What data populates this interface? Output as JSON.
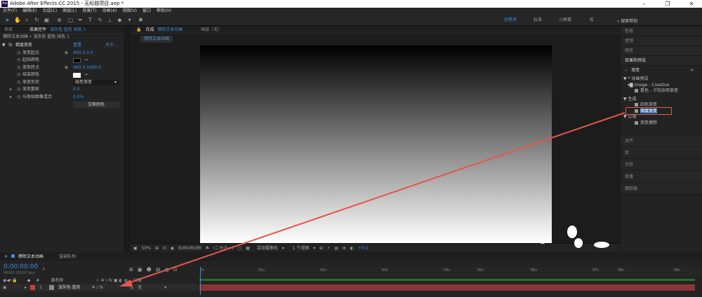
{
  "window": {
    "title": "Adobe After Effects CC 2015 - 无标题项目.aep *",
    "logo": "Ae"
  },
  "menu": [
    "文件(F)",
    "编辑(E)",
    "合成(C)",
    "图层(L)",
    "效果(T)",
    "动画(A)",
    "视图(V)",
    "窗口",
    "帮助(H)"
  ],
  "workspaces": [
    {
      "label": "创意项",
      "active": true
    },
    {
      "label": "标准",
      "active": false
    },
    {
      "label": "小屏幕",
      "active": false
    },
    {
      "label": "库",
      "active": false
    }
  ],
  "search": {
    "label": "搜索帮助"
  },
  "left": {
    "tab_project": "项目",
    "tab_fx": "效果控件",
    "tab_fx_layer": "浅灰色·蓝色 纯色 1",
    "breadcrumb": "擦除文本动画 • 浅灰色·蓝色 纯色 1",
    "effect": {
      "name": "梯度渐变",
      "reset": "重置",
      "about": "关于..."
    },
    "rows": [
      {
        "label": "渐变起点",
        "value": "960.0,0.0"
      },
      {
        "label": "起始颜色",
        "swatch": "#000000"
      },
      {
        "label": "渐变终点",
        "value": "960.0,1080.0"
      },
      {
        "label": "结束颜色",
        "swatch": "#ffffff"
      },
      {
        "label": "渐变形状",
        "value": "线性渐变"
      },
      {
        "label": "渐变散射",
        "value": "0.0"
      },
      {
        "label": "与原始图像混合",
        "value": "0.0%"
      }
    ],
    "swap_button": "交换颜色"
  },
  "comp": {
    "tab": "合成",
    "tab_name": "擦除文本动画",
    "tab_layer": "图层（无）",
    "subtab": "擦除文本动画",
    "zoom": "50%",
    "timecode": "0;00;00;00",
    "resolution": "(二分之一)",
    "camera": "活动摄像机",
    "views": "1 个视图",
    "exposure": "+0.0"
  },
  "right": {
    "top_sections": [
      "信息",
      "音频",
      "预览"
    ],
    "effects_header": "效果和预设",
    "search_value": "渐变",
    "tree": [
      {
        "text": "* 动画预设",
        "indent": 0,
        "kind": "folder"
      },
      {
        "text": "Image - Creative",
        "indent": 1,
        "kind": "folder"
      },
      {
        "text": "看色 - 夕阳余晖渐变",
        "indent": 2,
        "kind": "fx"
      },
      {
        "text": "生成",
        "indent": 0,
        "kind": "folder"
      },
      {
        "text": "四色渐变",
        "indent": 2,
        "kind": "fx"
      },
      {
        "text": "梯度渐变",
        "indent": 2,
        "kind": "fx",
        "highlight": true
      },
      {
        "text": "过渡",
        "indent": 0,
        "kind": "folder"
      },
      {
        "text": "渐变擦除",
        "indent": 2,
        "kind": "fx"
      }
    ],
    "bottom_sections": [
      "对齐",
      "库",
      "字符",
      "段落",
      "跟踪器"
    ]
  },
  "timeline": {
    "tab": "擦除文本动画",
    "tab_render": "渲染队列",
    "timecode": "0:00:00:00",
    "fps": "00000 (29.97 fps)",
    "ticks": [
      "0s",
      "01s",
      "02s",
      "03s",
      "04s",
      "05s",
      "06s",
      "07s",
      "08s",
      "09s"
    ],
    "col_name": "源名称",
    "col_parent": "父级",
    "layer": {
      "index": "1",
      "name": "浅灰色·蓝色",
      "parent": "无",
      "color": "#c94040"
    }
  }
}
